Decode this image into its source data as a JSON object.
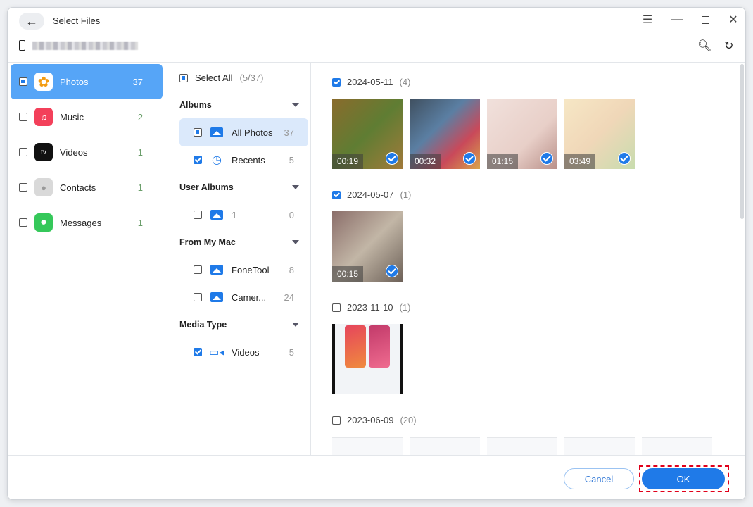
{
  "header": {
    "title": "Select Files"
  },
  "categories": [
    {
      "label": "Photos",
      "count": "37",
      "color": "#fff",
      "glyph": "✿"
    },
    {
      "label": "Music",
      "count": "2",
      "color": "#f3405a",
      "glyph": "♫"
    },
    {
      "label": "Videos",
      "count": "1",
      "color": "#111",
      "glyph": "tv"
    },
    {
      "label": "Contacts",
      "count": "1",
      "color": "#c9c9c9",
      "glyph": "👤"
    },
    {
      "label": "Messages",
      "count": "1",
      "color": "#35c85a",
      "glyph": "💬"
    }
  ],
  "middle": {
    "select_all": "Select All",
    "select_count": "(5/37)",
    "sections": [
      "Albums",
      "User Albums",
      "From My Mac",
      "Media Type"
    ],
    "items": [
      {
        "label": "All Photos",
        "count": "37"
      },
      {
        "label": "Recents",
        "count": "5"
      },
      {
        "label": "1",
        "count": "0"
      },
      {
        "label": "FoneTool",
        "count": "8"
      },
      {
        "label": "Camer...",
        "count": "24"
      },
      {
        "label": "Videos",
        "count": "5"
      }
    ]
  },
  "groups": [
    {
      "date": "2024-05-11",
      "count": "(4)",
      "durations": [
        "00:19",
        "00:32",
        "01:15",
        "03:49"
      ]
    },
    {
      "date": "2024-05-07",
      "count": "(1)",
      "durations": [
        "00:15"
      ]
    },
    {
      "date": "2023-11-10",
      "count": "(1)"
    },
    {
      "date": "2023-06-09",
      "count": "(20)"
    }
  ],
  "footer": {
    "cancel": "Cancel",
    "ok": "OK"
  },
  "colors": {
    "accent": "#1f7ae8",
    "selected": "#56a5f7"
  }
}
